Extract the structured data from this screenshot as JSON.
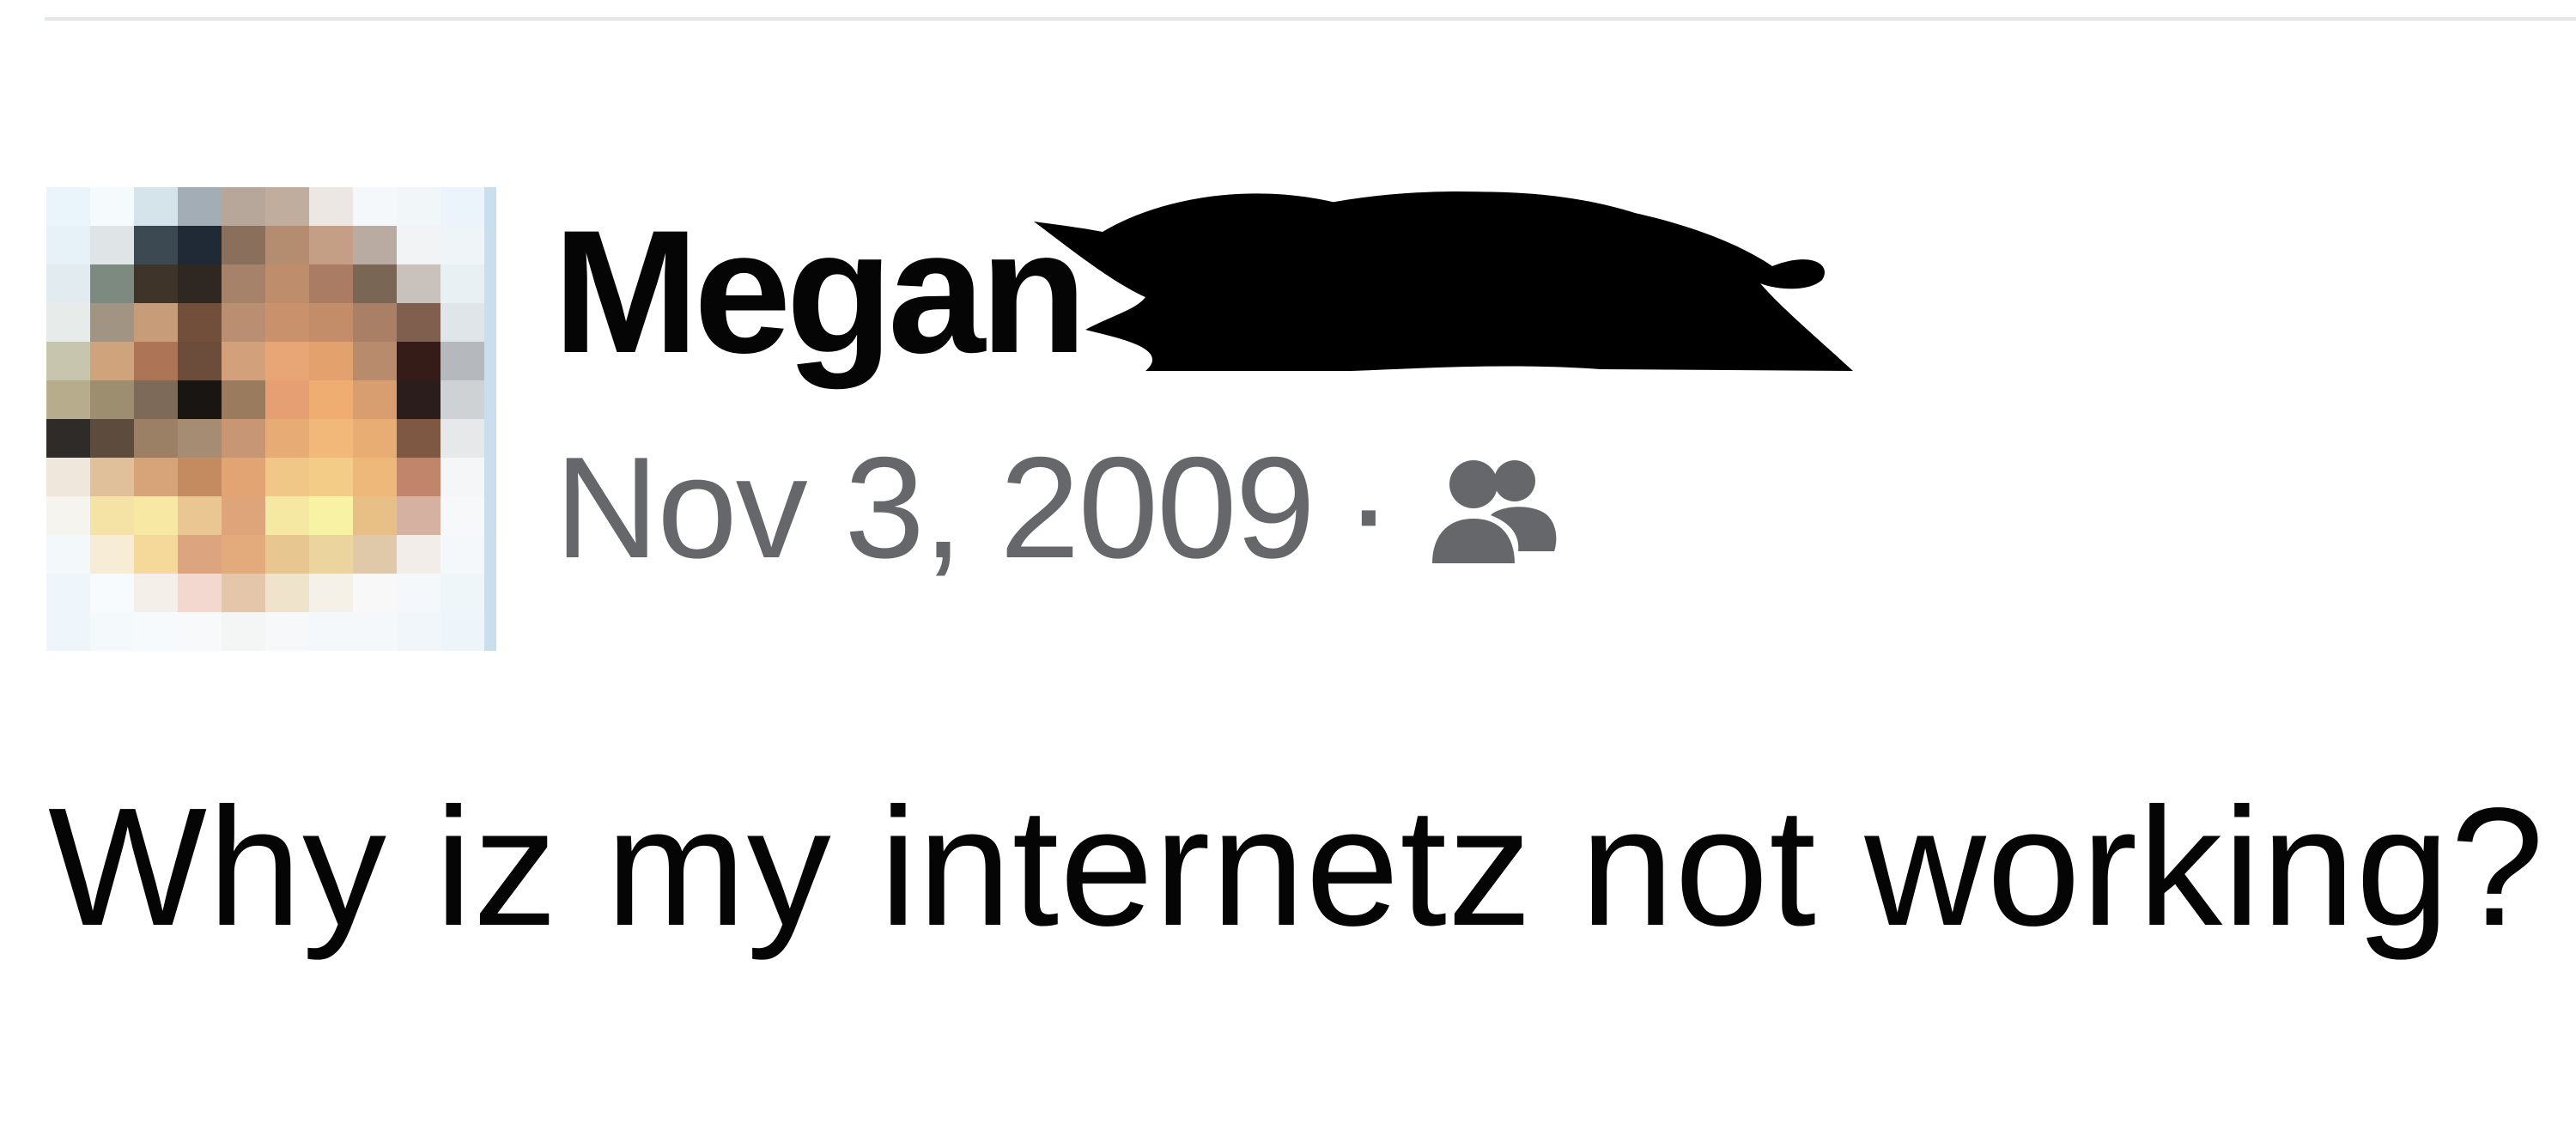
{
  "post": {
    "author": {
      "name": "Megan"
    },
    "date": "Nov 3, 2009",
    "separator": "·",
    "audience_icon": "friends-icon",
    "text": "Why iz my internetz not working?"
  },
  "colors": {
    "name_text": "#050505",
    "meta_text": "#65676b",
    "body_text": "#050505",
    "divider": "#e4e6ea",
    "redaction": "#000000"
  }
}
